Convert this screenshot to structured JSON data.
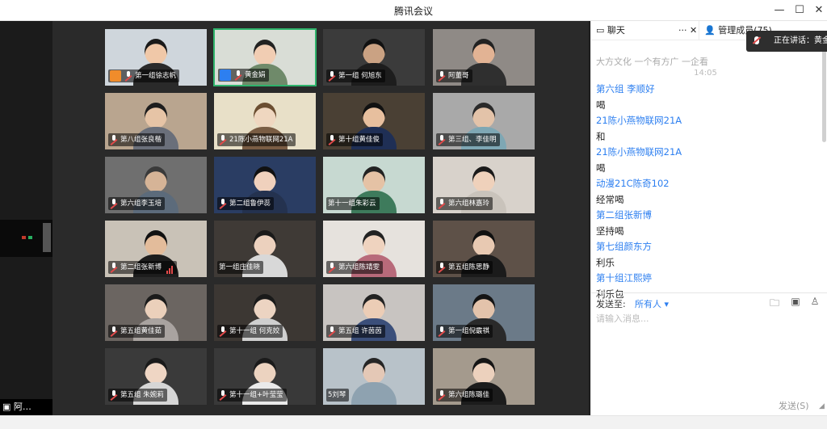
{
  "window": {
    "title": "腾讯会议",
    "min_glyph": "—",
    "max_glyph": "☐",
    "close_glyph": "✕"
  },
  "left_strip": {
    "bottom_label": "阿…"
  },
  "tiles": [
    {
      "name": "第一组徐志帆",
      "icon": "host-orange",
      "bg": "#cfd6dc",
      "skin": "#f0c8a8",
      "shirt": "#2a2a2a",
      "head": "#1a1a1a"
    },
    {
      "name": "黄金娟",
      "icon": "host-blue",
      "bg": "#d9ddd6",
      "skin": "#f1cdb3",
      "shirt": "#6f8a6a",
      "head": "#222",
      "active": true
    },
    {
      "name": "第一组 何旭东",
      "icon": "mic",
      "bg": "#3b3b3b",
      "skin": "#caa283",
      "shirt": "#1d1d1d",
      "head": "#111"
    },
    {
      "name": "阿董哥",
      "icon": "mic",
      "bg": "#8f8a86",
      "skin": "#e2b394",
      "shirt": "#2f2f2f",
      "head": "#222"
    },
    {
      "name": "第八组张良楷",
      "icon": "mic",
      "bg": "#b9a58f",
      "skin": "#e6c4a6",
      "shirt": "#6a6f7a",
      "head": "#1d1d1d"
    },
    {
      "name": "21陈小燕物联网21A",
      "icon": "mic",
      "bg": "#e8e0c8",
      "skin": "#efd7c0",
      "shirt": "#7a5d44",
      "head": "#6b4e31"
    },
    {
      "name": "第十组黄佳俊",
      "icon": "mic",
      "bg": "#4a4034",
      "skin": "#e7bf9e",
      "shirt": "#1f2f55",
      "head": "#111"
    },
    {
      "name": "第三组、李佳明",
      "icon": "mic",
      "bg": "#a9a9a9",
      "skin": "#e3c3a9",
      "shirt": "#7ea7b4",
      "head": "#2a2a2a"
    },
    {
      "name": "第六组李玉培",
      "icon": "mic",
      "bg": "#6f6f6f",
      "skin": "#d6b497",
      "shirt": "#5c6b7b",
      "head": "#3a3a3a"
    },
    {
      "name": "第二组鲁伊蕊",
      "icon": "mic",
      "bg": "#2a3d63",
      "skin": "#f0d1bd",
      "shirt": "#24324f",
      "head": "#111"
    },
    {
      "name": "第十一组朱彩云",
      "icon": "none",
      "bg": "#c7d9d1",
      "skin": "#e5c2a5",
      "shirt": "#3e7b5c",
      "head": "#222"
    },
    {
      "name": "第六组林嘉玲",
      "icon": "mic",
      "bg": "#d8d2cb",
      "skin": "#efd1bb",
      "shirt": "#c9c3bb",
      "head": "#1a1a1a"
    },
    {
      "name": "第二组张新博",
      "icon": "mic",
      "bg": "#c9c2b7",
      "skin": "#e3bc9b",
      "shirt": "#1d1d1d",
      "head": "#111",
      "signal": true
    },
    {
      "name": "第一组庄佳晓",
      "icon": "none",
      "bg": "#3f3a36",
      "skin": "#ecd1be",
      "shirt": "#d8d8d8",
      "head": "#1a1a1a"
    },
    {
      "name": "第六组陈靖雯",
      "icon": "mic",
      "bg": "#e6e2dd",
      "skin": "#efd3bf",
      "shirt": "#b86a7a",
      "head": "#222"
    },
    {
      "name": "第五组陈思静",
      "icon": "mic",
      "bg": "#5e5148",
      "skin": "#e8c9b2",
      "shirt": "#1b1b1b",
      "head": "#111"
    },
    {
      "name": "第五组黄佳茹",
      "icon": "mic",
      "bg": "#6b6561",
      "skin": "#ebd0bb",
      "shirt": "#a9a3a0",
      "head": "#1b1b1b"
    },
    {
      "name": "第十一组 何克姣",
      "icon": "mic",
      "bg": "#3c3733",
      "skin": "#ecd4c2",
      "shirt": "#cfcfcf",
      "head": "#1a1a1a"
    },
    {
      "name": "第五组 许茵茵",
      "icon": "mic",
      "bg": "#c8c4c1",
      "skin": "#eccdb6",
      "shirt": "#3b4f7a",
      "head": "#222"
    },
    {
      "name": "第一组倪霰祺",
      "icon": "mic",
      "bg": "#6b7a88",
      "skin": "#e3c3ab",
      "shirt": "#2a2a2a",
      "head": "#141414"
    },
    {
      "name": "第五组 朱婉莉",
      "icon": "mic",
      "bg": "#3a3a3a",
      "skin": "#efd6c4",
      "shirt": "#d6d6d6",
      "head": "#1a1a1a"
    },
    {
      "name": "第十一组+叶莹莹",
      "icon": "mic",
      "bg": "#393939",
      "skin": "#ecd3c0",
      "shirt": "#eaeaea",
      "head": "#1b1b1b"
    },
    {
      "name": "5刘琴",
      "icon": "none",
      "bg": "#b8c2c9",
      "skin": "#e4c8b6",
      "shirt": "#8ea2b0",
      "head": "#252525"
    },
    {
      "name": "第六组陈璐佳",
      "icon": "mic",
      "bg": "#a49a8d",
      "skin": "#ecd1bd",
      "shirt": "#1c1c1c",
      "head": "#151515"
    }
  ],
  "panel": {
    "tab_chat": "聊天",
    "tab_more": "···",
    "tab_close": "✕",
    "tab_members": "管理成员(75)",
    "speaking_label": "正在讲话：黄金娟",
    "cut_line": "大方文化 一个有方广 一企看",
    "time": "14:05",
    "messages": [
      {
        "sender": "第六组 李顺好",
        "text": "喝"
      },
      {
        "sender": "21陈小燕物联网21A",
        "text": "和"
      },
      {
        "sender": "21陈小燕物联网21A",
        "text": "喝"
      },
      {
        "sender": "动漫21C陈奇102",
        "text": "经常喝"
      },
      {
        "sender": "第二组张新博",
        "text": "坚持喝"
      },
      {
        "sender": "第七组颜东方",
        "text": "利乐"
      },
      {
        "sender": "第十组江熙婷",
        "text": "利乐包"
      }
    ],
    "send_to_label": "发送至:",
    "send_to_value": "所有人 ▾",
    "input_placeholder": "请输入消息...",
    "send_button": "发送(S)"
  },
  "icons": {
    "chat": "chat-bubble-icon",
    "members": "person-icon",
    "folder": "folder-icon",
    "screenshot": "screenshot-icon",
    "member_select": "person-select-icon"
  }
}
